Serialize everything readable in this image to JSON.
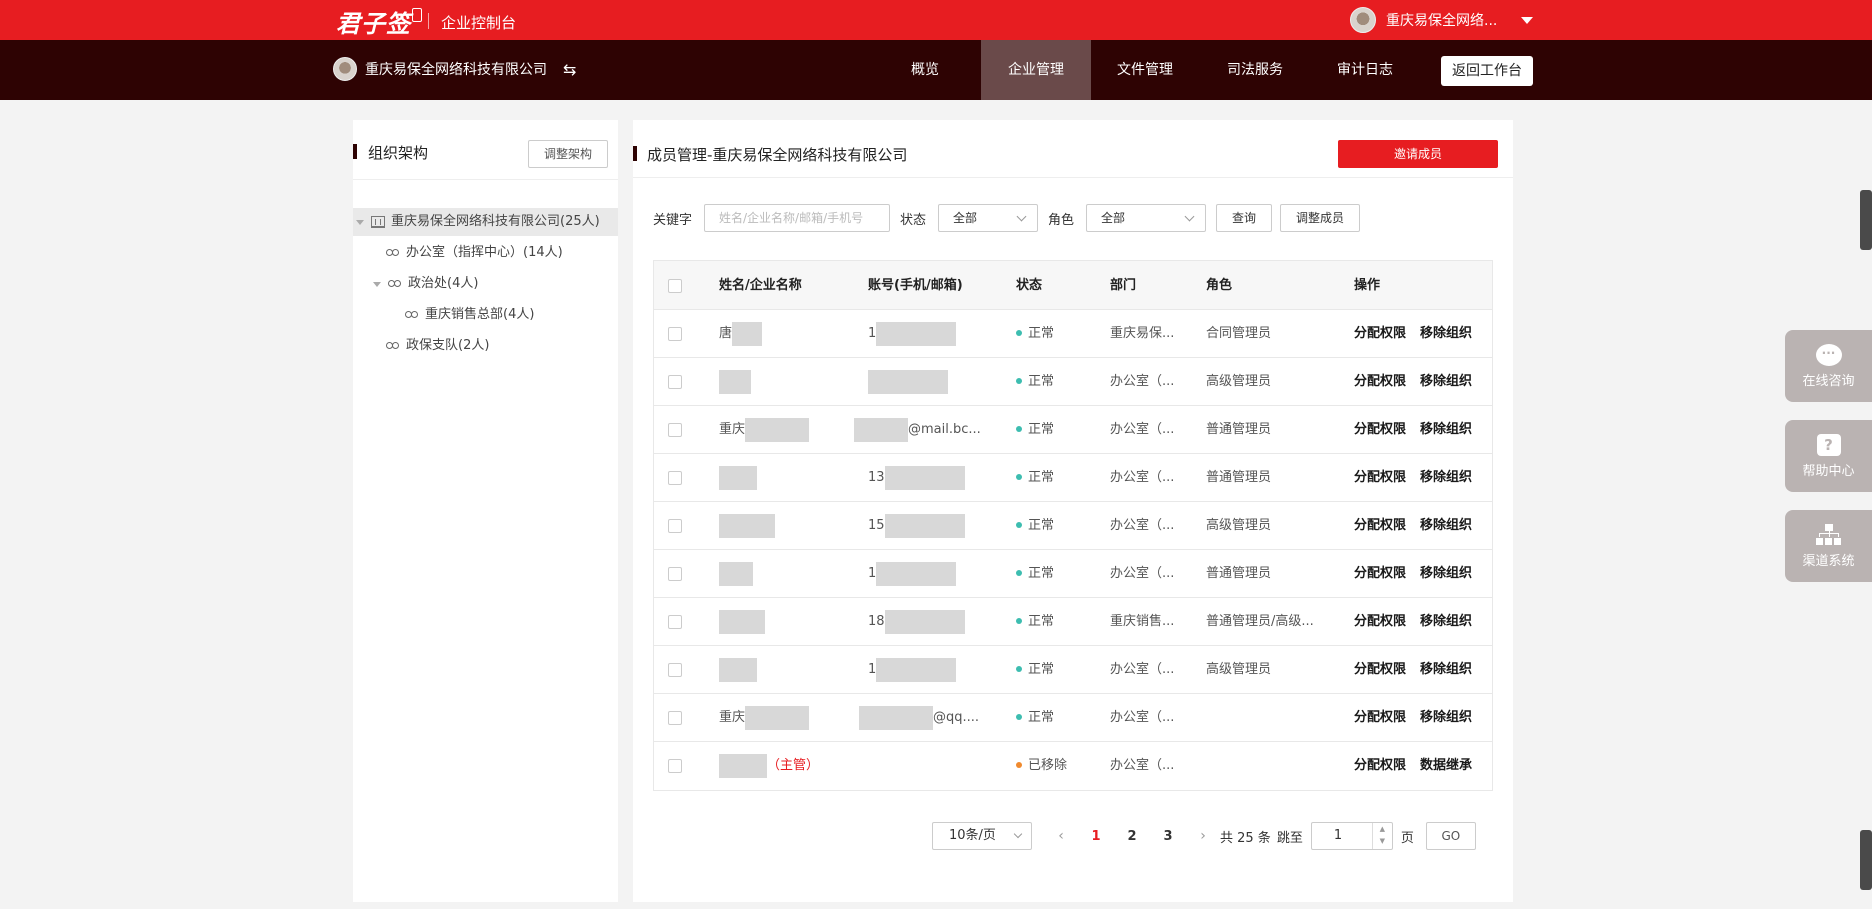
{
  "topbar": {
    "logo": "君子签",
    "title": "企业控制台",
    "user_name": "重庆易保全网络..."
  },
  "navbar": {
    "company": "重庆易保全网络科技有限公司",
    "items": [
      "概览",
      "企业管理",
      "文件管理",
      "司法服务",
      "审计日志"
    ],
    "active": "企业管理",
    "back_label": "返回工作台"
  },
  "org_panel": {
    "title": "组织架构",
    "adjust_label": "调整架构",
    "tree": [
      {
        "label": "重庆易保全网络科技有限公司(25人)",
        "level": 0,
        "expanded": true,
        "selected": true,
        "icon": "building-icon"
      },
      {
        "label": "办公室（指挥中心）(14人)",
        "level": 1,
        "expanded": false,
        "icon": "group-icon"
      },
      {
        "label": "政治处(4人)",
        "level": 1,
        "expanded": true,
        "icon": "group-icon"
      },
      {
        "label": "重庆销售总部(4人)",
        "level": 2,
        "expanded": false,
        "icon": "group-icon"
      },
      {
        "label": "政保支队(2人)",
        "level": 1,
        "expanded": false,
        "icon": "group-icon"
      }
    ]
  },
  "member_panel": {
    "title": "成员管理-重庆易保全网络科技有限公司",
    "invite_label": "邀请成员",
    "filters": {
      "keyword_label": "关键字",
      "keyword_placeholder": "姓名/企业名称/邮箱/手机号",
      "status_label": "状态",
      "status_value": "全部",
      "role_label": "角色",
      "role_value": "全部",
      "query_label": "查询",
      "adjust_label": "调整成员"
    },
    "columns": [
      "姓名/企业名称",
      "账号(手机/邮箱)",
      "状态",
      "部门",
      "角色",
      "操作"
    ],
    "rows": [
      {
        "name": "唐",
        "account": "1",
        "status": "正常",
        "dept": "重庆易保...",
        "role": "合同管理员",
        "action1": "分配权限",
        "action2": "移除组织"
      },
      {
        "name": "",
        "account": "",
        "status": "正常",
        "dept": "办公室（...",
        "role": "高级管理员",
        "action1": "分配权限",
        "action2": "移除组织"
      },
      {
        "name": "重庆",
        "account": "@mail.bc...",
        "status": "正常",
        "dept": "办公室（...",
        "role": "普通管理员",
        "action1": "分配权限",
        "action2": "移除组织"
      },
      {
        "name": "",
        "account": "13",
        "status": "正常",
        "dept": "办公室（...",
        "role": "普通管理员",
        "action1": "分配权限",
        "action2": "移除组织"
      },
      {
        "name": "",
        "account": "15",
        "status": "正常",
        "dept": "办公室（...",
        "role": "高级管理员",
        "action1": "分配权限",
        "action2": "移除组织"
      },
      {
        "name": "",
        "account": "1",
        "status": "正常",
        "dept": "办公室（...",
        "role": "普通管理员",
        "action1": "分配权限",
        "action2": "移除组织"
      },
      {
        "name": "",
        "account": "18",
        "status": "正常",
        "dept": "重庆销售...",
        "role": "普通管理员/高级...",
        "action1": "分配权限",
        "action2": "移除组织"
      },
      {
        "name": "",
        "account": "1",
        "status": "正常",
        "dept": "办公室（...",
        "role": "高级管理员",
        "action1": "分配权限",
        "action2": "移除组织"
      },
      {
        "name": "重庆",
        "account": "@qq....",
        "status": "正常",
        "dept": "办公室（...",
        "role": "",
        "action1": "分配权限",
        "action2": "移除组织"
      },
      {
        "name": "",
        "name_tag": "（主管）",
        "account": "",
        "status": "已移除",
        "dept": "办公室（...",
        "role": "",
        "action1": "分配权限",
        "action2": "数据继承"
      }
    ],
    "pagination": {
      "page_size": "10条/页",
      "pages": [
        "1",
        "2",
        "3"
      ],
      "current": "1",
      "total": "共 25 条",
      "jump_label": "跳至",
      "jump_value": "1",
      "page_unit": "页",
      "go_label": "GO"
    }
  },
  "float_menu": [
    {
      "label": "在线咨询",
      "icon": "chat-icon"
    },
    {
      "label": "帮助中心",
      "icon": "help-icon"
    },
    {
      "label": "渠道系统",
      "icon": "org-chart-icon"
    }
  ],
  "colors": {
    "brand_red": "#e71d21",
    "nav_dark": "#2e0303",
    "status_normal": "#3dbdb0",
    "status_removed": "#f08a2e"
  }
}
